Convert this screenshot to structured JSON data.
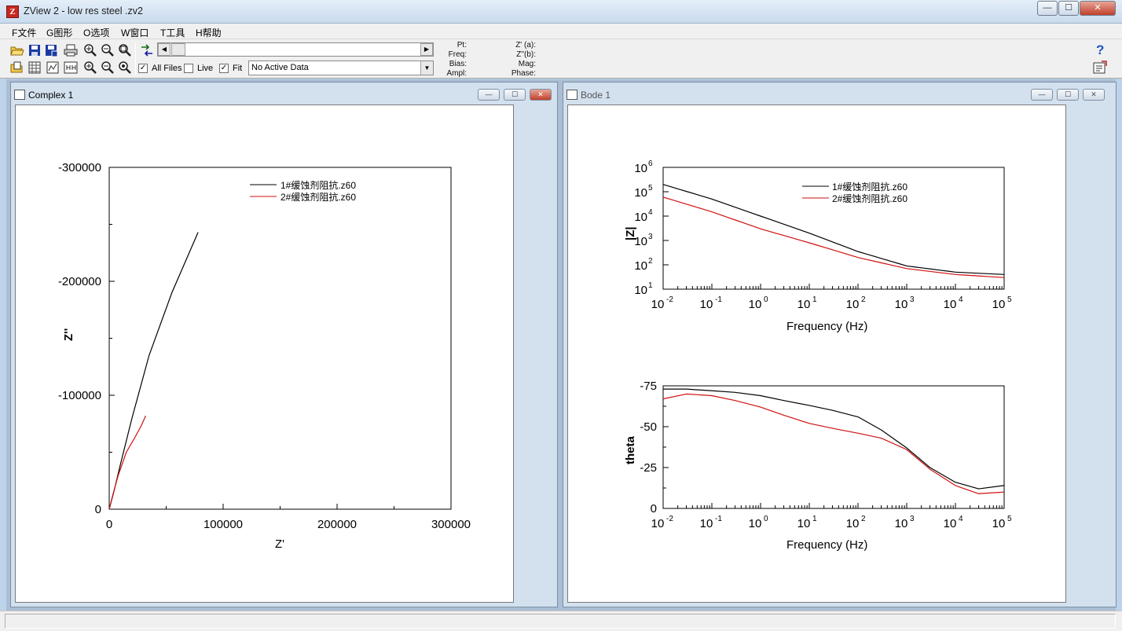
{
  "window": {
    "title": "ZView 2 - low res steel .zv2",
    "minimize": "—",
    "maximize": "☐",
    "close": "✕"
  },
  "menu": [
    "F文件",
    "G图形",
    "O选项",
    "W窗口",
    "T工具",
    "H帮助"
  ],
  "toolbar": {
    "checks": {
      "all_files": {
        "label": "All Files",
        "checked": true
      },
      "live": {
        "label": "Live",
        "checked": false
      },
      "fit": {
        "label": "Fit",
        "checked": true
      }
    },
    "data_combo": "No Active Data",
    "info_left": [
      "Pt:",
      "Freq:",
      "Bias:",
      "Ampl:"
    ],
    "info_right": [
      "Z' (a):",
      "Z''(b):",
      "Mag:",
      "Phase:"
    ]
  },
  "complex_window": {
    "title": "Complex 1",
    "xlabel": "Z'",
    "ylabel": "Z''",
    "y_ticks": [
      "-300000",
      "-200000",
      "-100000",
      "0"
    ],
    "x_ticks": [
      "0",
      "100000",
      "200000",
      "300000"
    ],
    "legend": [
      "1#缓蚀剂阻抗.z60",
      "2#缓蚀剂阻抗.z60"
    ]
  },
  "bode_window": {
    "title": "Bode 1",
    "top_ylabel": "|Z|",
    "bottom_ylabel": "theta",
    "xlabel": "Frequency (Hz)",
    "legend": [
      "1#缓蚀剂阻抗.z60",
      "2#缓蚀剂阻抗.z60"
    ],
    "x_tick_exponents": [
      "-2",
      "-1",
      "0",
      "1",
      "2",
      "3",
      "4",
      "5"
    ],
    "mag_tick_exponents": [
      "1",
      "2",
      "3",
      "4",
      "5",
      "6"
    ],
    "phase_ticks": [
      "-75",
      "-50",
      "-25",
      "0"
    ]
  },
  "colors": {
    "series1": "#000000",
    "series2": "#d01010"
  },
  "chart_data": [
    {
      "type": "line",
      "chart": "complex",
      "xlim": [
        0,
        300000
      ],
      "ylim": [
        0,
        -300000
      ],
      "series": [
        {
          "name": "1#缓蚀剂阻抗.z60",
          "x": [
            0,
            4000,
            10000,
            20000,
            35000,
            55000,
            78000
          ],
          "y": [
            0,
            -15000,
            -40000,
            -80000,
            -135000,
            -190000,
            -243000
          ]
        },
        {
          "name": "2#缓蚀剂阻抗.z60",
          "x": [
            0,
            3000,
            8000,
            15000,
            22000,
            28000,
            32000
          ],
          "y": [
            0,
            -12000,
            -30000,
            -50000,
            -62000,
            -73000,
            -82000
          ]
        }
      ]
    },
    {
      "type": "line",
      "chart": "bode-magnitude",
      "xscale": "log",
      "yscale": "log",
      "xlim": [
        0.01,
        100000
      ],
      "ylim": [
        10,
        1000000
      ],
      "series": [
        {
          "name": "1#缓蚀剂阻抗.z60",
          "x": [
            0.01,
            0.1,
            1,
            10,
            100,
            1000,
            10000,
            100000
          ],
          "y": [
            200000,
            50000,
            10000,
            2000,
            350,
            90,
            50,
            40
          ]
        },
        {
          "name": "2#缓蚀剂阻抗.z60",
          "x": [
            0.01,
            0.1,
            1,
            10,
            100,
            1000,
            10000,
            100000
          ],
          "y": [
            60000,
            15000,
            3000,
            800,
            200,
            70,
            40,
            30
          ]
        }
      ]
    },
    {
      "type": "line",
      "chart": "bode-phase",
      "xscale": "log",
      "xlim": [
        0.01,
        100000
      ],
      "ylim": [
        0,
        -75
      ],
      "series": [
        {
          "name": "1#缓蚀剂阻抗.z60",
          "x": [
            0.01,
            0.03,
            0.1,
            0.3,
            1,
            3,
            10,
            30,
            100,
            300,
            1000,
            3000,
            10000,
            30000,
            100000
          ],
          "y": [
            -73,
            -73,
            -72,
            -71,
            -69,
            -66,
            -63,
            -60,
            -56,
            -48,
            -37,
            -25,
            -16,
            -12,
            -14
          ]
        },
        {
          "name": "2#缓蚀剂阻抗.z60",
          "x": [
            0.01,
            0.03,
            0.1,
            0.3,
            1,
            3,
            10,
            30,
            100,
            300,
            1000,
            3000,
            10000,
            30000,
            100000
          ],
          "y": [
            -67,
            -70,
            -69,
            -66,
            -62,
            -57,
            -52,
            -49,
            -46,
            -43,
            -36,
            -24,
            -14,
            -9,
            -10
          ]
        }
      ]
    }
  ]
}
